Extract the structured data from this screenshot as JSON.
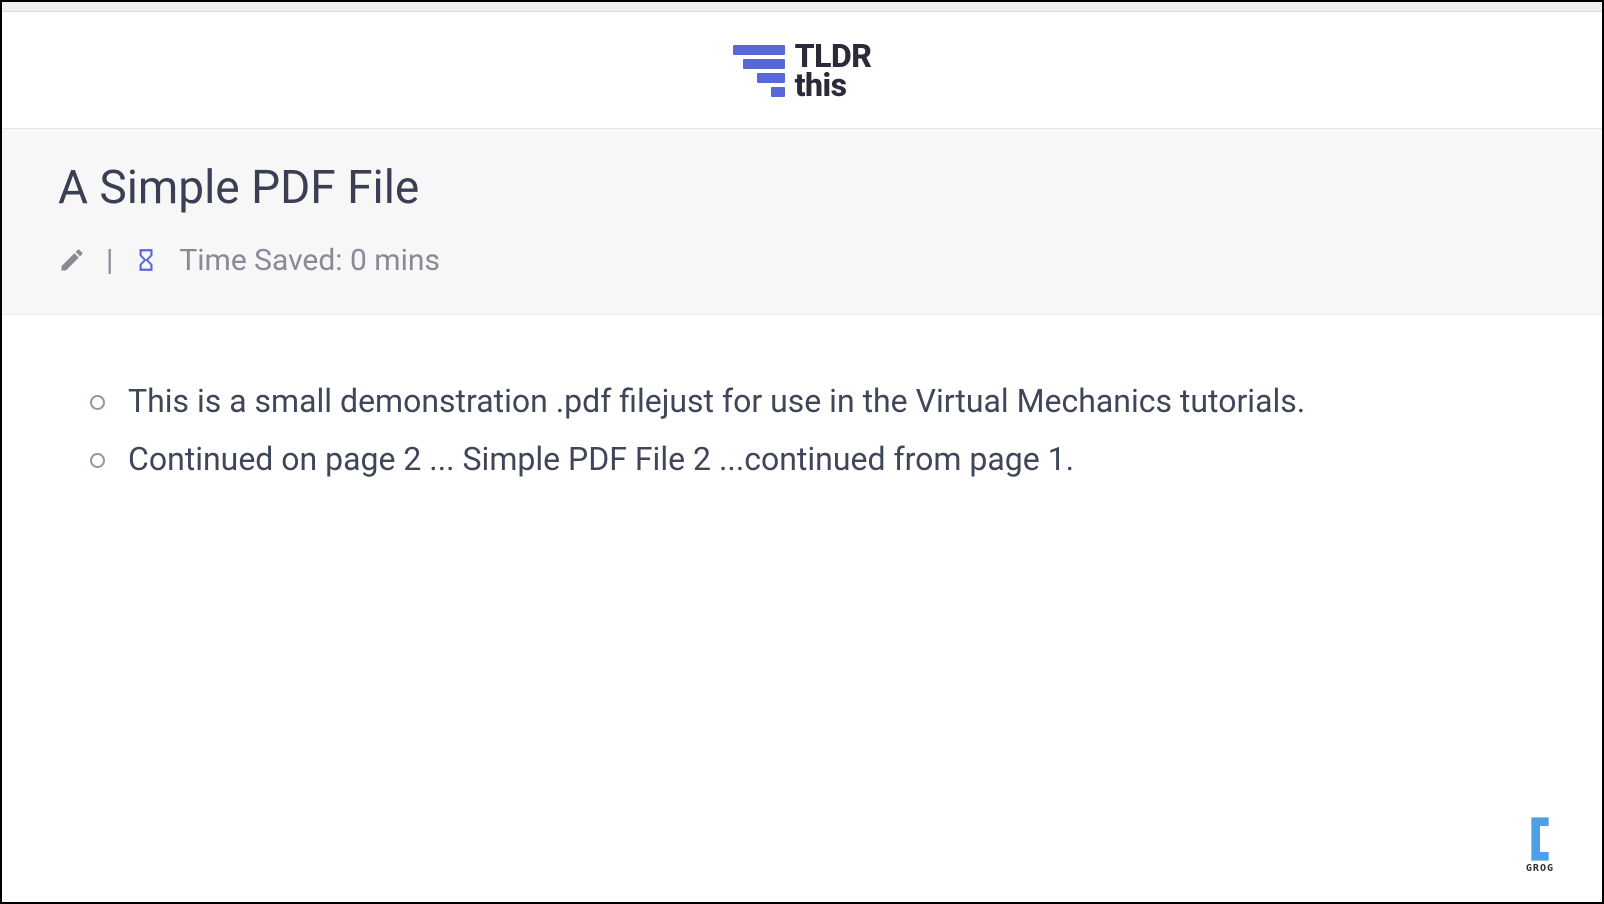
{
  "brand": {
    "line1": "TLDR",
    "line2": "this"
  },
  "page": {
    "title": "A Simple PDF File"
  },
  "meta": {
    "divider": "|",
    "time_saved_label": "Time Saved: 0 mins"
  },
  "summary": {
    "points": [
      "This is a small demonstration .pdf filejust for use in the Virtual Mechanics tutorials.",
      "Continued on page 2 ... Simple PDF File 2 ...continued from page 1."
    ]
  },
  "badge": {
    "label": "GROG"
  }
}
